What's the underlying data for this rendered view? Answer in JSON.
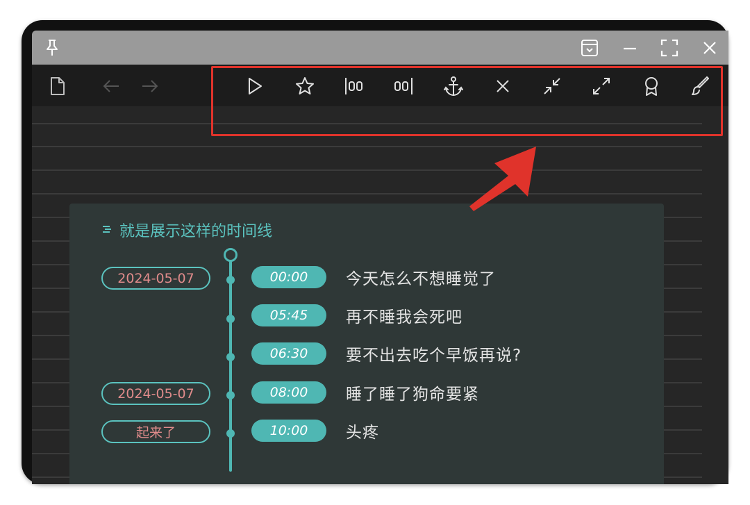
{
  "titlebar": {
    "icons": [
      "pin-icon",
      "dropdown-box-icon",
      "minimize-icon",
      "fullscreen-icon",
      "close-icon"
    ]
  },
  "toolbar": {
    "left_icons": [
      "file-icon",
      "back-arrow-icon",
      "forward-arrow-icon"
    ],
    "tools": [
      "play-icon",
      "star-icon",
      "align-left-icon",
      "align-right-icon",
      "anchor-icon",
      "x-icon",
      "collapse-icon",
      "expand-icon",
      "badge-icon",
      "brush-icon"
    ]
  },
  "card": {
    "title": "就是展示这样的时间线",
    "title_icon": "list-icon"
  },
  "timeline": {
    "events": [
      {
        "date": "2024-05-07",
        "time": "00:00",
        "text": "今天怎么不想睡觉了"
      },
      {
        "date": "",
        "time": "05:45",
        "text": "再不睡我会死吧"
      },
      {
        "date": "",
        "time": "06:30",
        "text": "要不出去吃个早饭再说?"
      },
      {
        "date": "2024-05-07",
        "time": "08:00",
        "text": "睡了睡了狗命要紧"
      },
      {
        "date": "起来了",
        "time": "10:00",
        "text": "头疼"
      }
    ]
  },
  "colors": {
    "accent": "#4fb7b3",
    "date_text": "#e08b8b",
    "highlight": "#e0332b"
  }
}
